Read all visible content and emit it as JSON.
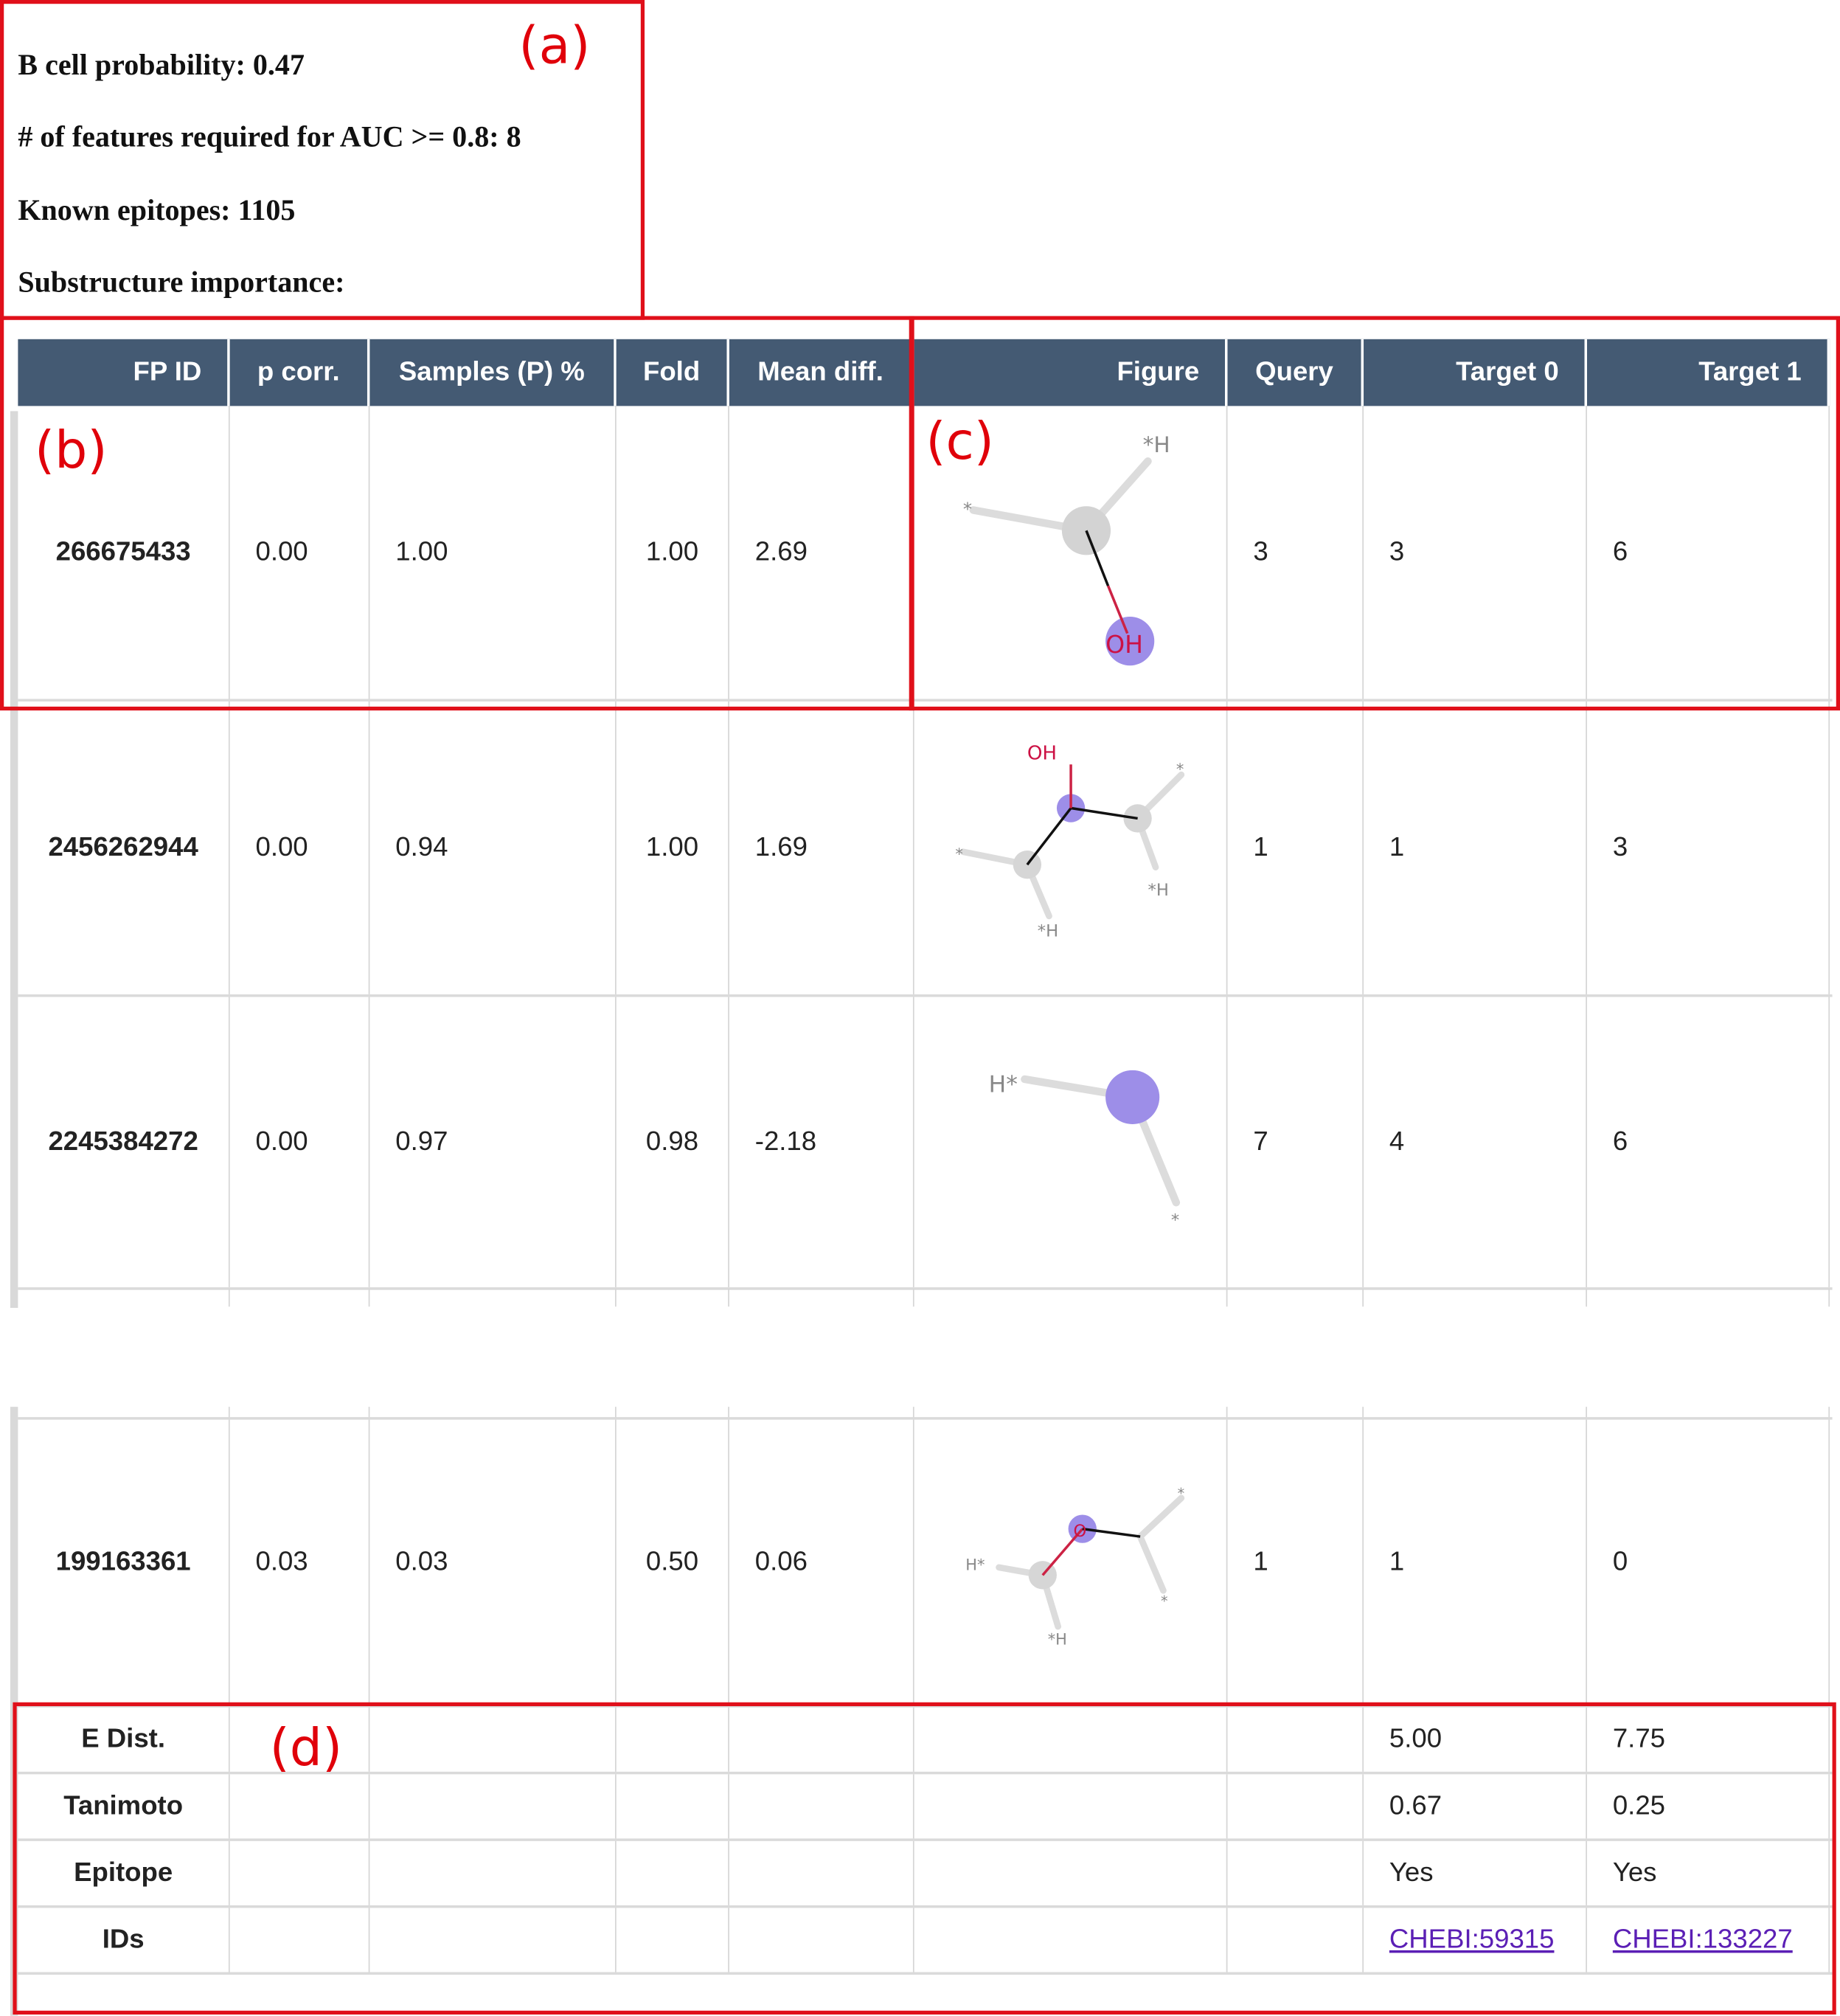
{
  "info": {
    "b_cell_probability": "B cell probability: 0.47",
    "features_required": "# of features required for AUC >= 0.8: 8",
    "known_epitopes": "Known epitopes: 1105",
    "substructure_importance": "Substructure importance:"
  },
  "panel_labels": {
    "a": "(a)",
    "b": "(b)",
    "c": "(c)",
    "d": "(d)"
  },
  "table": {
    "headers": [
      "FP ID",
      "p corr.",
      "Samples (P) %",
      "Fold",
      "Mean diff.",
      "Figure",
      "Query",
      "Target 0",
      "Target 1"
    ],
    "rows": [
      {
        "fp_id": "266675433",
        "p_corr": "0.00",
        "samples": "1.00",
        "fold": "1.00",
        "mean_diff": "2.69",
        "query": "3",
        "target0": "3",
        "target1": "6"
      },
      {
        "fp_id": "2456262944",
        "p_corr": "0.00",
        "samples": "0.94",
        "fold": "1.00",
        "mean_diff": "1.69",
        "query": "1",
        "target0": "1",
        "target1": "3"
      },
      {
        "fp_id": "2245384272",
        "p_corr": "0.00",
        "samples": "0.97",
        "fold": "0.98",
        "mean_diff": "-2.18",
        "query": "7",
        "target0": "4",
        "target1": "6"
      },
      {
        "fp_id": "199163361",
        "p_corr": "0.03",
        "samples": "0.03",
        "fold": "0.50",
        "mean_diff": "0.06",
        "query": "1",
        "target0": "1",
        "target1": "0"
      }
    ],
    "summary": [
      {
        "label": "E Dist.",
        "target0": "5.00",
        "target1": "7.75"
      },
      {
        "label": "Tanimoto",
        "target0": "0.67",
        "target1": "0.25"
      },
      {
        "label": "Epitope",
        "target0": "Yes",
        "target1": "Yes"
      },
      {
        "label": "IDs",
        "target0": "CHEBI:59315",
        "target1": "CHEBI:133227"
      }
    ]
  },
  "molecules": {
    "m1": {
      "a1": "*H",
      "a2": "*",
      "a3": "OH"
    },
    "m2": {
      "a1": "OH",
      "a2": "*",
      "a3": "*",
      "a4": "*H",
      "a5": "*H"
    },
    "m3": {
      "a1": "H*",
      "a2": "*"
    },
    "m4": {
      "a1": "O",
      "a2": "H*",
      "a3": "*H",
      "a4": "*",
      "a5": "*"
    }
  },
  "colors": {
    "header_bg": "#445a73",
    "highlight_red": "#e0101a",
    "atom_purple": "#9d8ee8",
    "link": "#5b1fb5"
  }
}
